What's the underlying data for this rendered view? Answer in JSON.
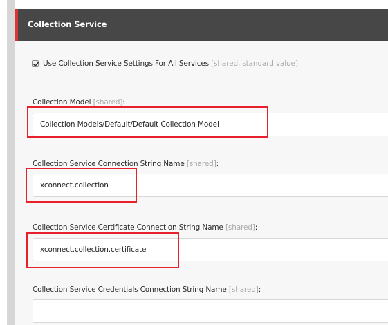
{
  "section": {
    "title": "Collection Service"
  },
  "use_settings": {
    "label": "Use Collection Service Settings For All Services",
    "hint": "[shared, standard value]",
    "checked": true
  },
  "fields": [
    {
      "label": "Collection Model",
      "hint": "[shared]",
      "colon": ":",
      "value": "Collection Models/Default/Default Collection Model"
    },
    {
      "label": "Collection Service Connection String Name",
      "hint": "[shared]",
      "colon": ":",
      "value": "xconnect.collection"
    },
    {
      "label": "Collection Service Certificate Connection String Name",
      "hint": "[shared]",
      "colon": ":",
      "value": "xconnect.collection.certificate"
    },
    {
      "label": "Collection Service Credentials Connection String Name",
      "hint": "[shared]",
      "colon": ":",
      "value": ""
    }
  ],
  "colors": {
    "header_bg": "#474747",
    "header_accent": "#dc3333",
    "panel_bg": "#f7f7f7",
    "highlight": "#e8202a",
    "hint_text": "#aaaaaa"
  }
}
